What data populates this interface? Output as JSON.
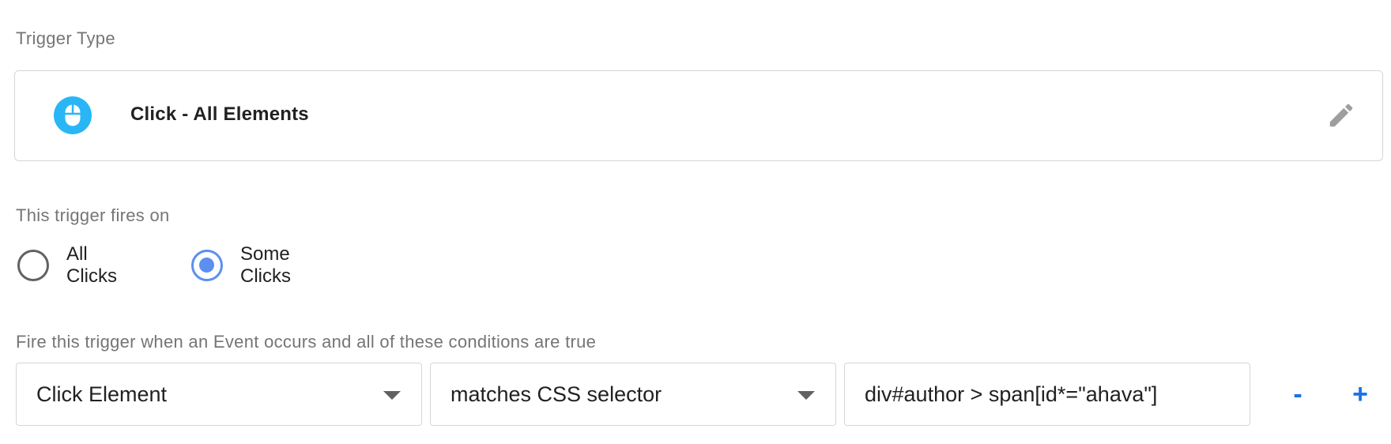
{
  "trigger_type": {
    "section_label": "Trigger Type",
    "name": "Click - All Elements",
    "icon": "mouse-icon",
    "icon_color": "#29b6f6",
    "edit_icon": "pencil-icon"
  },
  "fires_on": {
    "section_label": "This trigger fires on",
    "options": [
      {
        "label": "All Clicks",
        "selected": false
      },
      {
        "label": "Some Clicks",
        "selected": true
      }
    ],
    "selected_color": "#5c8ff0"
  },
  "conditions": {
    "section_label": "Fire this trigger when an Event occurs and all of these conditions are true",
    "rows": [
      {
        "variable": "Click Element",
        "operator": "matches CSS selector",
        "value": "div#author > span[id*=\"ahava\"]"
      }
    ],
    "remove_label": "-",
    "add_label": "+",
    "action_color": "#1a73e8"
  }
}
